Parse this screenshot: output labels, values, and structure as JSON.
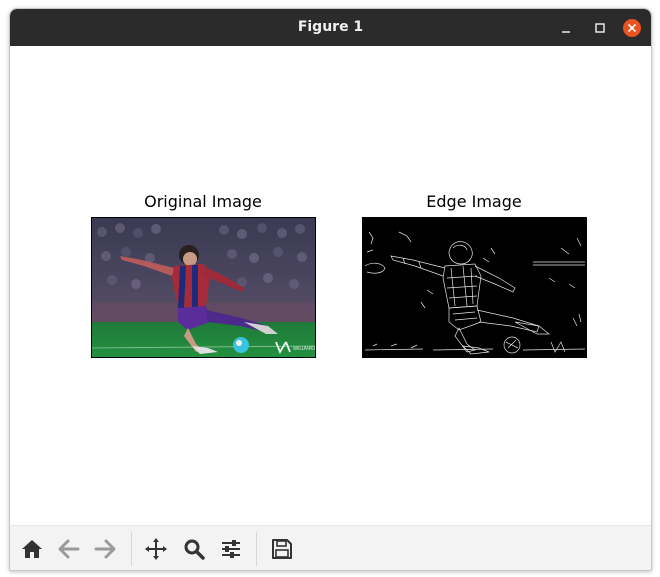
{
  "window": {
    "title": "Figure 1"
  },
  "figure": {
    "subplots": [
      {
        "title": "Original Image",
        "kind": "photo"
      },
      {
        "title": "Edge Image",
        "kind": "edge-map"
      }
    ]
  },
  "toolbar": {
    "tools": [
      {
        "name": "home-icon",
        "enabled": true
      },
      {
        "name": "back-arrow-icon",
        "enabled": false
      },
      {
        "name": "forward-arrow-icon",
        "enabled": false
      },
      {
        "name": "pan-icon",
        "enabled": true
      },
      {
        "name": "zoom-icon",
        "enabled": true
      },
      {
        "name": "configure-subplots-icon",
        "enabled": true
      },
      {
        "name": "save-icon",
        "enabled": true
      }
    ]
  },
  "colors": {
    "titlebar": "#2b2b2b",
    "close_button": "#e95420",
    "toolbar_bg": "#f3f3f3",
    "icon_active": "#333333",
    "icon_disabled": "#9a9a9a"
  }
}
